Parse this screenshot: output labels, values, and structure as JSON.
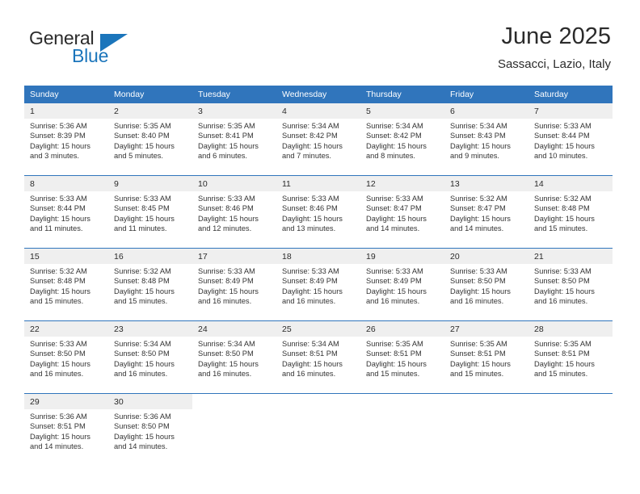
{
  "brand": {
    "name_part1": "General",
    "name_part2": "Blue",
    "accent_color": "#1b75bb"
  },
  "header": {
    "month_title": "June 2025",
    "location": "Sassacci, Lazio, Italy"
  },
  "theme": {
    "header_row_bg": "#3075bc",
    "daynum_bg": "#efefef",
    "separator_color": "#3075bc"
  },
  "weekday_headers": [
    "Sunday",
    "Monday",
    "Tuesday",
    "Wednesday",
    "Thursday",
    "Friday",
    "Saturday"
  ],
  "weeks": [
    {
      "days": [
        {
          "num": "1",
          "sunrise": "Sunrise: 5:36 AM",
          "sunset": "Sunset: 8:39 PM",
          "daylight1": "Daylight: 15 hours",
          "daylight2": "and 3 minutes."
        },
        {
          "num": "2",
          "sunrise": "Sunrise: 5:35 AM",
          "sunset": "Sunset: 8:40 PM",
          "daylight1": "Daylight: 15 hours",
          "daylight2": "and 5 minutes."
        },
        {
          "num": "3",
          "sunrise": "Sunrise: 5:35 AM",
          "sunset": "Sunset: 8:41 PM",
          "daylight1": "Daylight: 15 hours",
          "daylight2": "and 6 minutes."
        },
        {
          "num": "4",
          "sunrise": "Sunrise: 5:34 AM",
          "sunset": "Sunset: 8:42 PM",
          "daylight1": "Daylight: 15 hours",
          "daylight2": "and 7 minutes."
        },
        {
          "num": "5",
          "sunrise": "Sunrise: 5:34 AM",
          "sunset": "Sunset: 8:42 PM",
          "daylight1": "Daylight: 15 hours",
          "daylight2": "and 8 minutes."
        },
        {
          "num": "6",
          "sunrise": "Sunrise: 5:34 AM",
          "sunset": "Sunset: 8:43 PM",
          "daylight1": "Daylight: 15 hours",
          "daylight2": "and 9 minutes."
        },
        {
          "num": "7",
          "sunrise": "Sunrise: 5:33 AM",
          "sunset": "Sunset: 8:44 PM",
          "daylight1": "Daylight: 15 hours",
          "daylight2": "and 10 minutes."
        }
      ]
    },
    {
      "days": [
        {
          "num": "8",
          "sunrise": "Sunrise: 5:33 AM",
          "sunset": "Sunset: 8:44 PM",
          "daylight1": "Daylight: 15 hours",
          "daylight2": "and 11 minutes."
        },
        {
          "num": "9",
          "sunrise": "Sunrise: 5:33 AM",
          "sunset": "Sunset: 8:45 PM",
          "daylight1": "Daylight: 15 hours",
          "daylight2": "and 11 minutes."
        },
        {
          "num": "10",
          "sunrise": "Sunrise: 5:33 AM",
          "sunset": "Sunset: 8:46 PM",
          "daylight1": "Daylight: 15 hours",
          "daylight2": "and 12 minutes."
        },
        {
          "num": "11",
          "sunrise": "Sunrise: 5:33 AM",
          "sunset": "Sunset: 8:46 PM",
          "daylight1": "Daylight: 15 hours",
          "daylight2": "and 13 minutes."
        },
        {
          "num": "12",
          "sunrise": "Sunrise: 5:33 AM",
          "sunset": "Sunset: 8:47 PM",
          "daylight1": "Daylight: 15 hours",
          "daylight2": "and 14 minutes."
        },
        {
          "num": "13",
          "sunrise": "Sunrise: 5:32 AM",
          "sunset": "Sunset: 8:47 PM",
          "daylight1": "Daylight: 15 hours",
          "daylight2": "and 14 minutes."
        },
        {
          "num": "14",
          "sunrise": "Sunrise: 5:32 AM",
          "sunset": "Sunset: 8:48 PM",
          "daylight1": "Daylight: 15 hours",
          "daylight2": "and 15 minutes."
        }
      ]
    },
    {
      "days": [
        {
          "num": "15",
          "sunrise": "Sunrise: 5:32 AM",
          "sunset": "Sunset: 8:48 PM",
          "daylight1": "Daylight: 15 hours",
          "daylight2": "and 15 minutes."
        },
        {
          "num": "16",
          "sunrise": "Sunrise: 5:32 AM",
          "sunset": "Sunset: 8:48 PM",
          "daylight1": "Daylight: 15 hours",
          "daylight2": "and 15 minutes."
        },
        {
          "num": "17",
          "sunrise": "Sunrise: 5:33 AM",
          "sunset": "Sunset: 8:49 PM",
          "daylight1": "Daylight: 15 hours",
          "daylight2": "and 16 minutes."
        },
        {
          "num": "18",
          "sunrise": "Sunrise: 5:33 AM",
          "sunset": "Sunset: 8:49 PM",
          "daylight1": "Daylight: 15 hours",
          "daylight2": "and 16 minutes."
        },
        {
          "num": "19",
          "sunrise": "Sunrise: 5:33 AM",
          "sunset": "Sunset: 8:49 PM",
          "daylight1": "Daylight: 15 hours",
          "daylight2": "and 16 minutes."
        },
        {
          "num": "20",
          "sunrise": "Sunrise: 5:33 AM",
          "sunset": "Sunset: 8:50 PM",
          "daylight1": "Daylight: 15 hours",
          "daylight2": "and 16 minutes."
        },
        {
          "num": "21",
          "sunrise": "Sunrise: 5:33 AM",
          "sunset": "Sunset: 8:50 PM",
          "daylight1": "Daylight: 15 hours",
          "daylight2": "and 16 minutes."
        }
      ]
    },
    {
      "days": [
        {
          "num": "22",
          "sunrise": "Sunrise: 5:33 AM",
          "sunset": "Sunset: 8:50 PM",
          "daylight1": "Daylight: 15 hours",
          "daylight2": "and 16 minutes."
        },
        {
          "num": "23",
          "sunrise": "Sunrise: 5:34 AM",
          "sunset": "Sunset: 8:50 PM",
          "daylight1": "Daylight: 15 hours",
          "daylight2": "and 16 minutes."
        },
        {
          "num": "24",
          "sunrise": "Sunrise: 5:34 AM",
          "sunset": "Sunset: 8:50 PM",
          "daylight1": "Daylight: 15 hours",
          "daylight2": "and 16 minutes."
        },
        {
          "num": "25",
          "sunrise": "Sunrise: 5:34 AM",
          "sunset": "Sunset: 8:51 PM",
          "daylight1": "Daylight: 15 hours",
          "daylight2": "and 16 minutes."
        },
        {
          "num": "26",
          "sunrise": "Sunrise: 5:35 AM",
          "sunset": "Sunset: 8:51 PM",
          "daylight1": "Daylight: 15 hours",
          "daylight2": "and 15 minutes."
        },
        {
          "num": "27",
          "sunrise": "Sunrise: 5:35 AM",
          "sunset": "Sunset: 8:51 PM",
          "daylight1": "Daylight: 15 hours",
          "daylight2": "and 15 minutes."
        },
        {
          "num": "28",
          "sunrise": "Sunrise: 5:35 AM",
          "sunset": "Sunset: 8:51 PM",
          "daylight1": "Daylight: 15 hours",
          "daylight2": "and 15 minutes."
        }
      ]
    },
    {
      "days": [
        {
          "num": "29",
          "sunrise": "Sunrise: 5:36 AM",
          "sunset": "Sunset: 8:51 PM",
          "daylight1": "Daylight: 15 hours",
          "daylight2": "and 14 minutes."
        },
        {
          "num": "30",
          "sunrise": "Sunrise: 5:36 AM",
          "sunset": "Sunset: 8:50 PM",
          "daylight1": "Daylight: 15 hours",
          "daylight2": "and 14 minutes."
        },
        {
          "num": "",
          "sunrise": "",
          "sunset": "",
          "daylight1": "",
          "daylight2": ""
        },
        {
          "num": "",
          "sunrise": "",
          "sunset": "",
          "daylight1": "",
          "daylight2": ""
        },
        {
          "num": "",
          "sunrise": "",
          "sunset": "",
          "daylight1": "",
          "daylight2": ""
        },
        {
          "num": "",
          "sunrise": "",
          "sunset": "",
          "daylight1": "",
          "daylight2": ""
        },
        {
          "num": "",
          "sunrise": "",
          "sunset": "",
          "daylight1": "",
          "daylight2": ""
        }
      ]
    }
  ]
}
